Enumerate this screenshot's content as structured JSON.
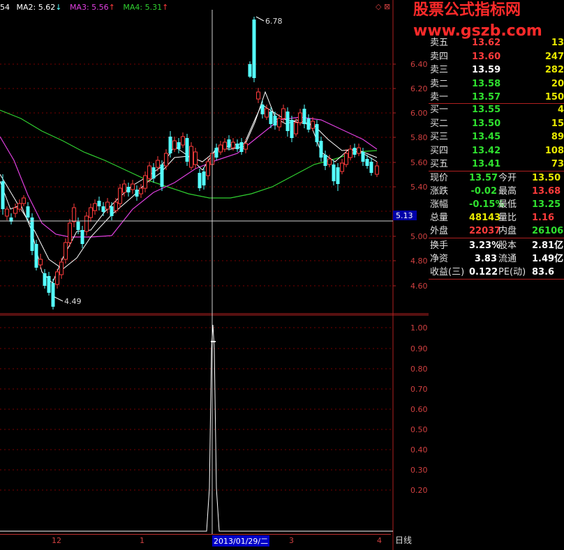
{
  "header": {
    "ma1_partial": "54",
    "ma2": "MA2: 5.62",
    "ma3": "MA3: 5.56",
    "ma4": "MA4: 5.31"
  },
  "watermark": {
    "line1": "股票公式指标网",
    "line2": "www.gszb.com"
  },
  "price_axis": [
    "6.40",
    "6.20",
    "6.00",
    "5.80",
    "5.60",
    "5.40",
    "5.20",
    "5.00",
    "4.80",
    "4.60"
  ],
  "price_cursor_label": "5.13",
  "indicator_axis": [
    "1.00",
    "0.90",
    "0.80",
    "0.70",
    "0.60",
    "0.50",
    "0.40",
    "0.30",
    "0.20"
  ],
  "annotations": {
    "high": "6.78",
    "low": "4.49"
  },
  "dates": {
    "d12": "12",
    "d1": "1",
    "selected": "2013/01/29/二",
    "d3": "3",
    "d4": "4",
    "period": "日线"
  },
  "order_book": {
    "sell": [
      {
        "label": "卖五",
        "price": "13.62",
        "vol": "13"
      },
      {
        "label": "卖四",
        "price": "13.60",
        "vol": "247"
      },
      {
        "label": "卖三",
        "price": "13.59",
        "vol": "282"
      },
      {
        "label": "卖二",
        "price": "13.58",
        "vol": "20"
      },
      {
        "label": "卖一",
        "price": "13.57",
        "vol": "150"
      }
    ],
    "buy": [
      {
        "label": "买一",
        "price": "13.55",
        "vol": "4"
      },
      {
        "label": "买二",
        "price": "13.50",
        "vol": "15"
      },
      {
        "label": "买三",
        "price": "13.45",
        "vol": "89"
      },
      {
        "label": "买四",
        "price": "13.42",
        "vol": "108"
      },
      {
        "label": "买五",
        "price": "13.41",
        "vol": "73"
      }
    ]
  },
  "quote": [
    {
      "l1": "现价",
      "v1": "13.57",
      "l2": "今开",
      "v2": "13.50"
    },
    {
      "l1": "涨跌",
      "v1": "-0.02",
      "l2": "最高",
      "v2": "13.68"
    },
    {
      "l1": "涨幅",
      "v1": "-0.15%",
      "l2": "最低",
      "v2": "13.25"
    },
    {
      "l1": "总量",
      "v1": "48143",
      "l2": "量比",
      "v2": "1.16"
    },
    {
      "l1": "外盘",
      "v1": "22037",
      "l2": "内盘",
      "v2": "26106"
    },
    {
      "l1": "换手",
      "v1": "3.23%",
      "l2": "股本",
      "v2": "2.81亿"
    },
    {
      "l1": "净资",
      "v1": "3.83",
      "l2": "流通",
      "v2": "1.49亿"
    },
    {
      "l1": "收益(三)",
      "v1": "0.122",
      "l2": "PE(动)",
      "v2": "83.6"
    }
  ],
  "colors": {
    "up": "#ff3b3b",
    "down": "#54ffff",
    "ma1": "#ffffff",
    "ma2": "#ffffff",
    "ma3": "#e040e0",
    "ma4": "#30d030",
    "grid": "#8b0000"
  }
}
